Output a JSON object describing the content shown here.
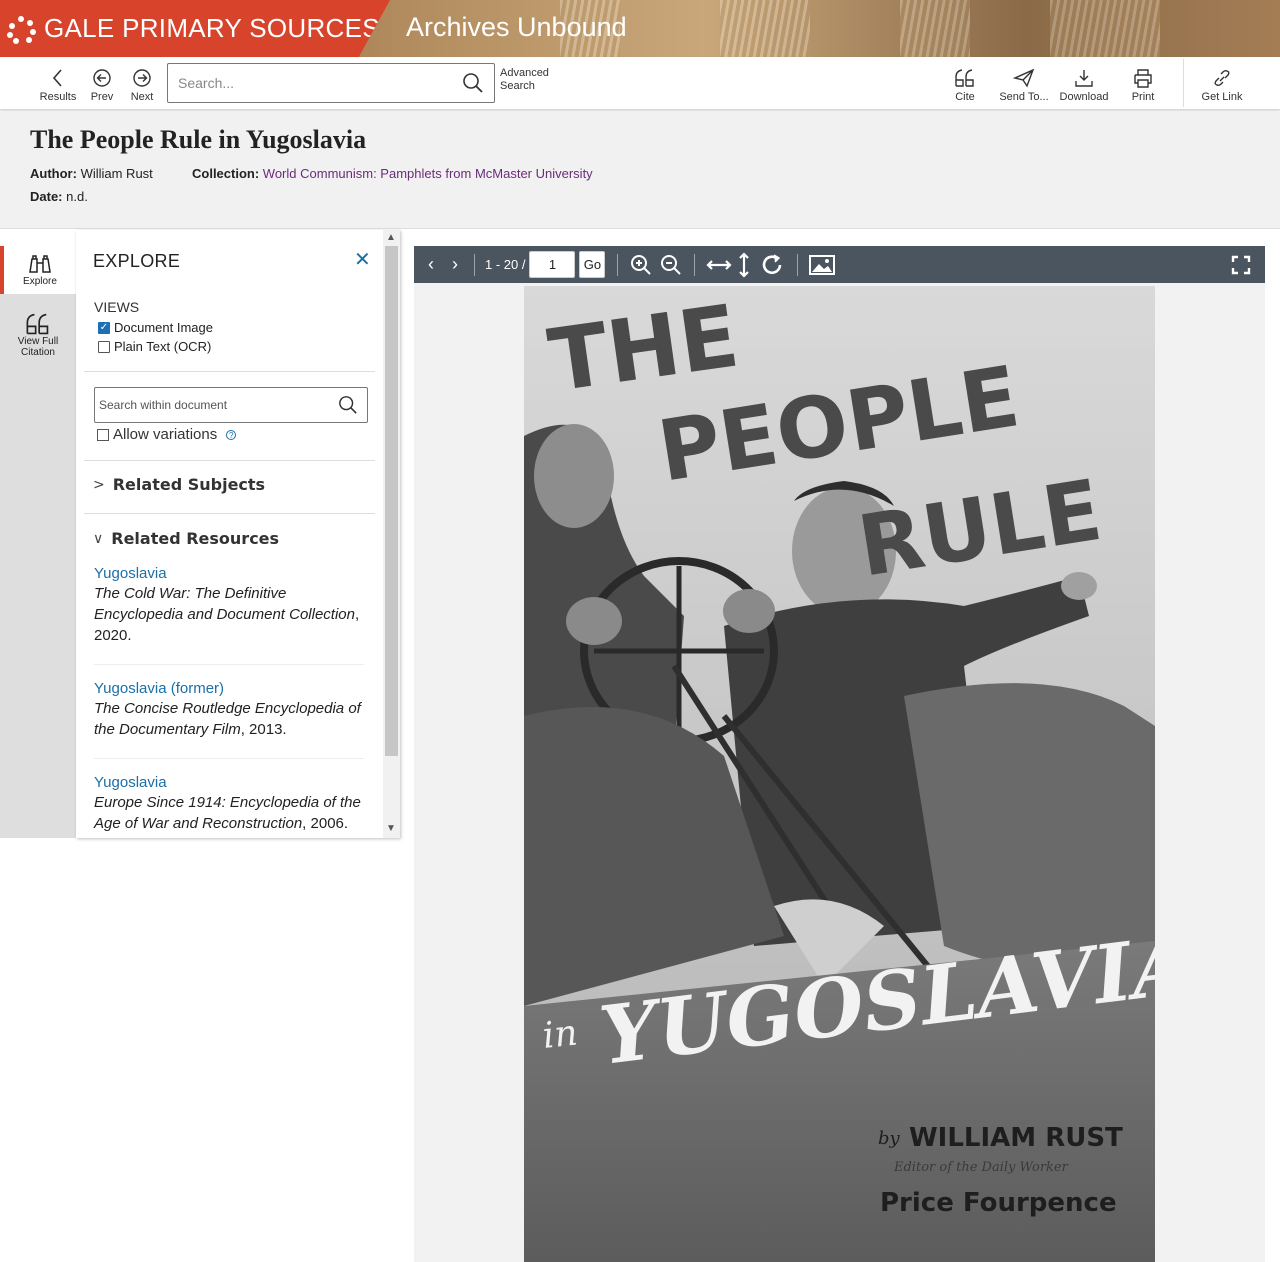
{
  "brand": {
    "name": "GALE PRIMARY SOURCES",
    "product": "Archives Unbound"
  },
  "toolbar": {
    "results_label": "Results",
    "prev_label": "Prev",
    "next_label": "Next",
    "search_placeholder": "Search...",
    "advanced_search_label": "Advanced Search",
    "cite_label": "Cite",
    "send_to_label": "Send To...",
    "download_label": "Download",
    "print_label": "Print",
    "get_link_label": "Get Link"
  },
  "document": {
    "title": "The People Rule in Yugoslavia",
    "author_label": "Author:",
    "author": "William Rust",
    "collection_label": "Collection:",
    "collection": "World Communism: Pamphlets from McMaster University",
    "date_label": "Date:",
    "date": "n.d."
  },
  "rail": {
    "explore_label": "Explore",
    "view_full_citation_label": "View Full Citation"
  },
  "explore": {
    "heading": "EXPLORE",
    "views_label": "VIEWS",
    "views": [
      {
        "label": "Document Image",
        "checked": true
      },
      {
        "label": "Plain Text (OCR)",
        "checked": false
      }
    ],
    "search_placeholder": "Search within document",
    "allow_variations_label": "Allow variations",
    "related_subjects_label": "Related Subjects",
    "related_resources_label": "Related Resources",
    "resources": [
      {
        "title": "Yugoslavia",
        "source": "The Cold War: The Definitive Encyclopedia and Document Collection",
        "year": ", 2020."
      },
      {
        "title": "Yugoslavia (former)",
        "source": "The Concise Routledge Encyclopedia of the Documentary Film",
        "year": ", 2013."
      },
      {
        "title": "Yugoslavia",
        "source": "Europe Since 1914: Encyclopedia of the Age of War and Reconstruction",
        "year": ", 2006."
      }
    ]
  },
  "viewer": {
    "page_range": "1 - 20 /",
    "current_page": "1",
    "go_label": "Go"
  },
  "cover": {
    "line1": "THE",
    "line2": "PEOPLE",
    "line3": "RULE",
    "in_word": "in",
    "country": "YUGOSLAVIA",
    "by_word": "by",
    "author": "WILLIAM RUST",
    "author_note": "Editor of the Daily Worker",
    "price": "Price Fourpence"
  },
  "colors": {
    "brand_red": "#d8432b",
    "link_blue": "#1a6fa8",
    "collection_purple": "#6b2c7a",
    "viewer_bar": "#4a5560"
  }
}
